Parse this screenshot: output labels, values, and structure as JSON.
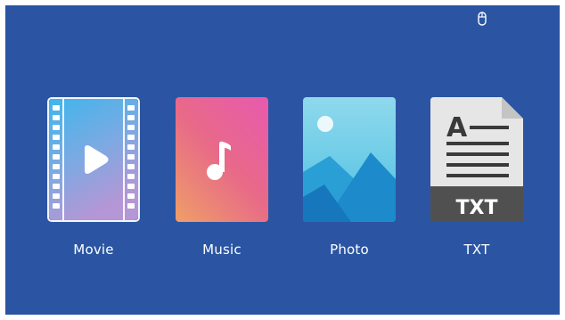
{
  "menu": {
    "items": [
      {
        "label": "Movie",
        "icon": "movie-icon",
        "selected": true
      },
      {
        "label": "Music",
        "icon": "music-icon",
        "selected": false
      },
      {
        "label": "Photo",
        "icon": "photo-icon",
        "selected": false
      },
      {
        "label": "TXT",
        "icon": "txt-icon",
        "selected": false
      }
    ]
  },
  "status": {
    "icon": "mouse-icon"
  },
  "txt_badge": "TXT",
  "colors": {
    "background": "#2b55a3",
    "label": "#ffffff",
    "selection_border": "#f2f5fa"
  }
}
